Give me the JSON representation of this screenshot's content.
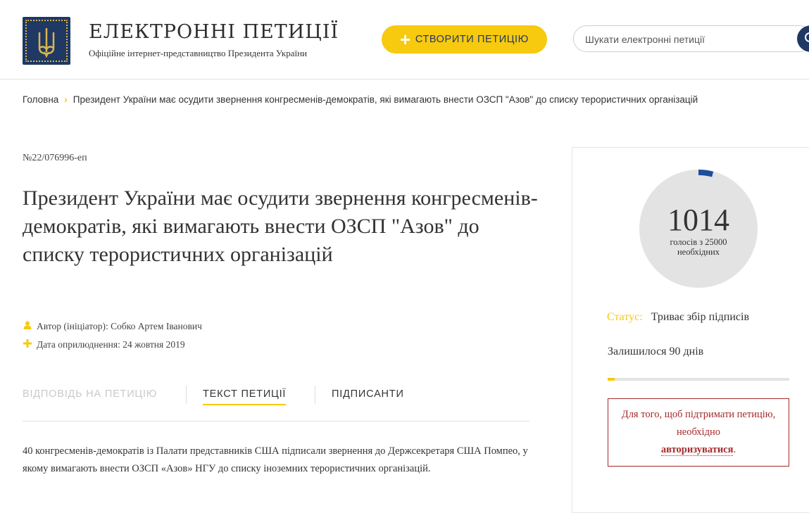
{
  "header": {
    "title": "ЕЛЕКТРОННІ ПЕТИЦІЇ",
    "subtitle": "Офіційне інтернет-представництво Президента України",
    "create_label": "СТВОРИТИ ПЕТИЦІЮ",
    "search_placeholder": "Шукати електронні петиції"
  },
  "breadcrumb": {
    "home": "Головна",
    "current": "Президент України має осудити звернення конгресменів-демократів, які вимагають внести ОЗСП \"Азов\" до списку терористичних організацій"
  },
  "petition": {
    "number": "№22/076996-еп",
    "title": "Президент України має осудити звернення конгресменів-демократів, які вимагають внести ОЗСП \"Азов\" до списку терористичних організацій",
    "author": "Автор (ініціатор): Собко Артем Іванович",
    "date": "Дата оприлюднення: 24 жовтня 2019",
    "body": "40 конгресменів-демократів із Палати представників США підписали звернення до Держсекретаря США Помпео, у якому вимагають внести ОЗСП «Азов» НГУ до списку іноземних терористичних організацій."
  },
  "tabs": [
    {
      "label": "ВІДПОВІДЬ НА ПЕТИЦІЮ"
    },
    {
      "label": "ТЕКСТ ПЕТИЦІЇ"
    },
    {
      "label": "ПІДПИСАНТИ"
    }
  ],
  "sidebar": {
    "votes": "1014",
    "votes_sub": "голосів з 25000 необхідних",
    "votes_count": 1014,
    "votes_needed": 25000,
    "status_label": "Статус:",
    "status_value": "Триває збір підписів",
    "days_left": "Залишилося 90 днів",
    "auth_text": "Для того, щоб підтримати петицію, необхідно",
    "auth_link": "авторизуватися",
    "auth_end": "."
  },
  "colors": {
    "accent": "#f7c90f",
    "brand": "#1f3864",
    "alert": "#a52a2a"
  }
}
